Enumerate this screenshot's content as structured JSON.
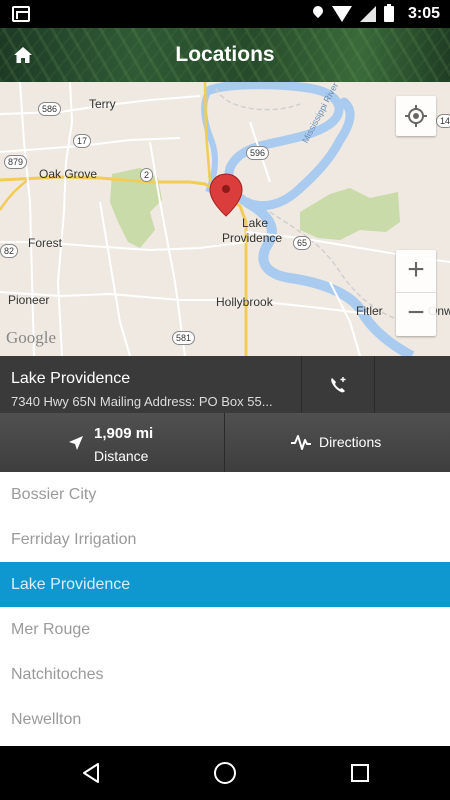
{
  "status_bar": {
    "time": "3:05"
  },
  "header": {
    "title": "Locations"
  },
  "map": {
    "places": [
      "Terry",
      "Oak Grove",
      "Forest",
      "Pioneer",
      "Lake",
      "Providence",
      "Hollybrook",
      "Fitler",
      "Onw"
    ],
    "routes": [
      "586",
      "17",
      "879",
      "2",
      "596",
      "65",
      "581",
      "82",
      "14"
    ],
    "river_label": "Mississippi River",
    "logo": "Google",
    "zoom_in": "+",
    "zoom_out": "−"
  },
  "location": {
    "name": "Lake Providence",
    "address": "7340 Hwy 65N Mailing Address: PO Box 55..."
  },
  "distance": {
    "value": "1,909 mi",
    "label": "Distance"
  },
  "directions": {
    "label": "Directions"
  },
  "locations_list": [
    {
      "name": "Bossier City"
    },
    {
      "name": "Ferriday Irrigation"
    },
    {
      "name": "Lake Providence"
    },
    {
      "name": "Mer Rouge"
    },
    {
      "name": "Natchitoches"
    },
    {
      "name": "Newellton"
    }
  ],
  "selected_index": 2,
  "colors": {
    "accent": "#0e98cf",
    "pin": "#db3c3c",
    "river": "#a9cbef"
  }
}
